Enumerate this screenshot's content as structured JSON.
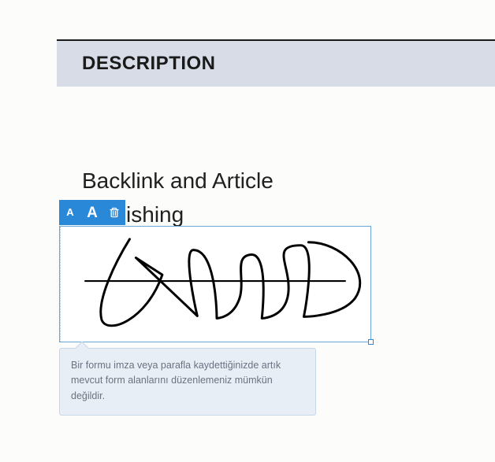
{
  "header": {
    "title": "DESCRIPTION"
  },
  "body": {
    "line1": "Backlink and Article",
    "line2": "Publishing"
  },
  "toolbar": {
    "small_a": "A",
    "large_a": "A",
    "delete_icon": "trash-icon"
  },
  "tooltip": {
    "text": "Bir formu imza veya parafla kaydettiğinizde artık mevcut form alanlarını düzenlemeniz mümkün değildir."
  },
  "colors": {
    "accent": "#2a88d8",
    "header_bg": "#d7dce7",
    "tip_bg": "#e7eef6"
  }
}
